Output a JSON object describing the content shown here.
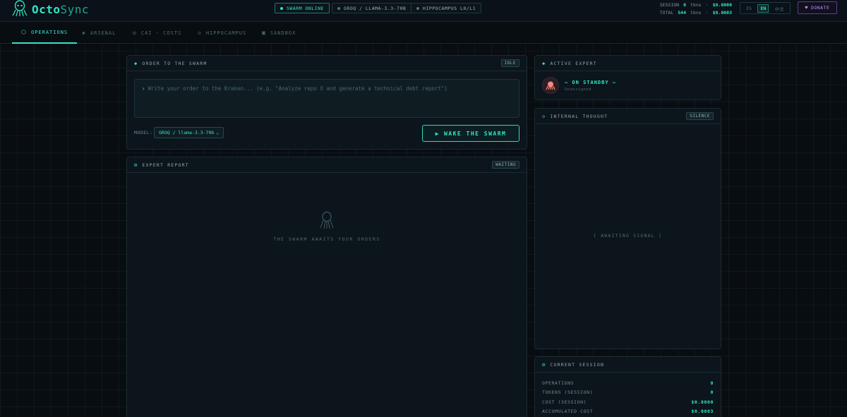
{
  "app": {
    "name_part1": "Octo",
    "name_part2": "Sync"
  },
  "header": {
    "status_online": "SWARM ONLINE",
    "model_chip": "GROQ / LLAMA-3.3-70B",
    "memory_chip": "HIPPOCAMPUS L0/L1",
    "stats": {
      "session_label": "SESSION",
      "session_tokens": "0",
      "session_unit": "tkns",
      "session_cost": "$0.0000",
      "total_label": "TOTAL",
      "total_tokens": "544",
      "total_unit": "tkns",
      "total_cost": "$0.0003",
      "separator": "·"
    },
    "languages": [
      "ES",
      "EN",
      "中文"
    ],
    "active_language": "EN",
    "donate_label": "DONATE"
  },
  "tabs": [
    {
      "label": "OPERATIONS",
      "icon": "hexagon-icon",
      "active": true
    },
    {
      "label": "ARSENAL",
      "icon": "diamond-icon",
      "active": false
    },
    {
      "label": "C4I · COSTS",
      "icon": "target-icon",
      "active": false
    },
    {
      "label": "HIPPOCAMPUS",
      "icon": "diamond-outline-icon",
      "active": false
    },
    {
      "label": "SANDBOX",
      "icon": "square-icon",
      "active": false
    }
  ],
  "order_panel": {
    "title": "ORDER TO THE SWARM",
    "badge": "IDLE",
    "input_placeholder": "Write your order to the Kraken... (e.g. \"Analyze repo X and generate a technical debt report\")",
    "model_label": "MODEL:",
    "model_value": "GROQ / llama-3.3-70b",
    "wake_button": "WAKE THE SWARM"
  },
  "report_panel": {
    "title": "EXPERT REPORT",
    "badge": "WAITING",
    "empty_text": "THE SWARM AWAITS YOUR ORDERS"
  },
  "active_expert": {
    "title": "ACTIVE EXPERT",
    "status": "— ON STANDBY —",
    "assignment": "Unassigned"
  },
  "internal_thought": {
    "title": "INTERNAL THOUGHT",
    "badge": "SILENCE",
    "empty_text": "[ AWAITING SIGNAL ]"
  },
  "current_session": {
    "title": "CURRENT SESSION",
    "rows": [
      {
        "label": "OPERATIONS",
        "value": "0"
      },
      {
        "label": "TOKENS (SESSION)",
        "value": "0"
      },
      {
        "label": "COST (SESSION)",
        "value": "$0.0000"
      },
      {
        "label": "ACCUMULATED COST",
        "value": "$0.0003"
      }
    ]
  },
  "colors": {
    "accent": "#31e6c6",
    "background": "#080d12",
    "panel": "#0c151b",
    "donate": "#b197f0"
  }
}
